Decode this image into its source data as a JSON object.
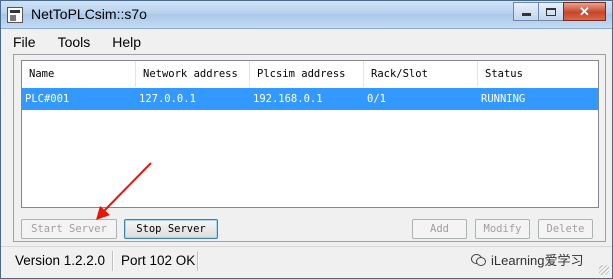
{
  "window": {
    "title": "NetToPLCsim::s7o"
  },
  "menu": {
    "items": [
      {
        "label": "File"
      },
      {
        "label": "Tools"
      },
      {
        "label": "Help"
      }
    ]
  },
  "table": {
    "columns": [
      "Name",
      "Network address",
      "Plcsim address",
      "Rack/Slot",
      "Status"
    ],
    "rows": [
      {
        "name": "PLC#001",
        "network_address": "127.0.0.1",
        "plcsim_address": "192.168.0.1",
        "rack_slot": "0/1",
        "status": "RUNNING",
        "selected": true
      }
    ]
  },
  "buttons": {
    "start_server": {
      "label": "Start Server",
      "enabled": false
    },
    "stop_server": {
      "label": "Stop Server",
      "enabled": true
    },
    "add": {
      "label": "Add",
      "enabled": false
    },
    "modify": {
      "label": "Modify",
      "enabled": false
    },
    "delete": {
      "label": "Delete",
      "enabled": false
    }
  },
  "status_bar": {
    "version": "Version 1.2.2.0",
    "port": "Port 102 OK"
  },
  "watermark": {
    "text": "iLearning爱学习"
  },
  "colors": {
    "selection": "#3399ff",
    "annotation_arrow": "#e8140c",
    "close_button": "#c6452c"
  }
}
